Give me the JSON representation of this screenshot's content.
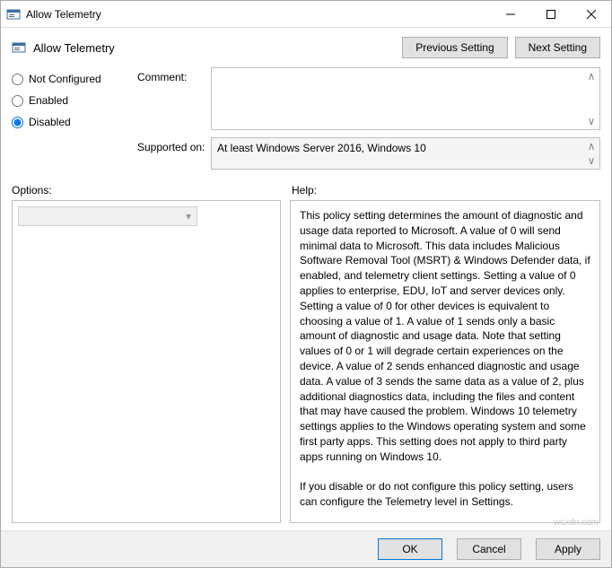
{
  "window": {
    "title": "Allow Telemetry"
  },
  "header": {
    "title": "Allow Telemetry",
    "prev_btn": "Previous Setting",
    "next_btn": "Next Setting"
  },
  "state": {
    "not_configured": "Not Configured",
    "enabled": "Enabled",
    "disabled": "Disabled",
    "selected": "disabled"
  },
  "fields": {
    "comment_label": "Comment:",
    "comment_value": "",
    "supported_label": "Supported on:",
    "supported_value": "At least Windows Server 2016, Windows 10"
  },
  "panels": {
    "options_label": "Options:",
    "help_label": "Help:",
    "options_placeholder": "",
    "help_text": "This policy setting determines the amount of diagnostic and usage data reported to Microsoft. A value of 0 will send minimal data to Microsoft. This data includes Malicious Software Removal Tool (MSRT) & Windows Defender data, if enabled, and telemetry client settings. Setting a value of 0 applies to enterprise, EDU, IoT and server devices only. Setting a value of 0 for other devices is equivalent to choosing a value of 1. A value of 1 sends only a basic amount of diagnostic and usage data. Note that setting values of 0 or 1 will degrade certain experiences on the device. A value of 2 sends enhanced diagnostic and usage data. A value of 3 sends the same data as a value of 2, plus additional diagnostics data, including the files and content that may have caused the problem. Windows 10 telemetry settings applies to the Windows operating system and some first party apps. This setting does not apply to third party apps running on Windows 10.\n\nIf you disable or do not configure this policy setting, users can configure the Telemetry level in Settings."
  },
  "footer": {
    "ok": "OK",
    "cancel": "Cancel",
    "apply": "Apply"
  },
  "watermark": "wsxdn.com"
}
